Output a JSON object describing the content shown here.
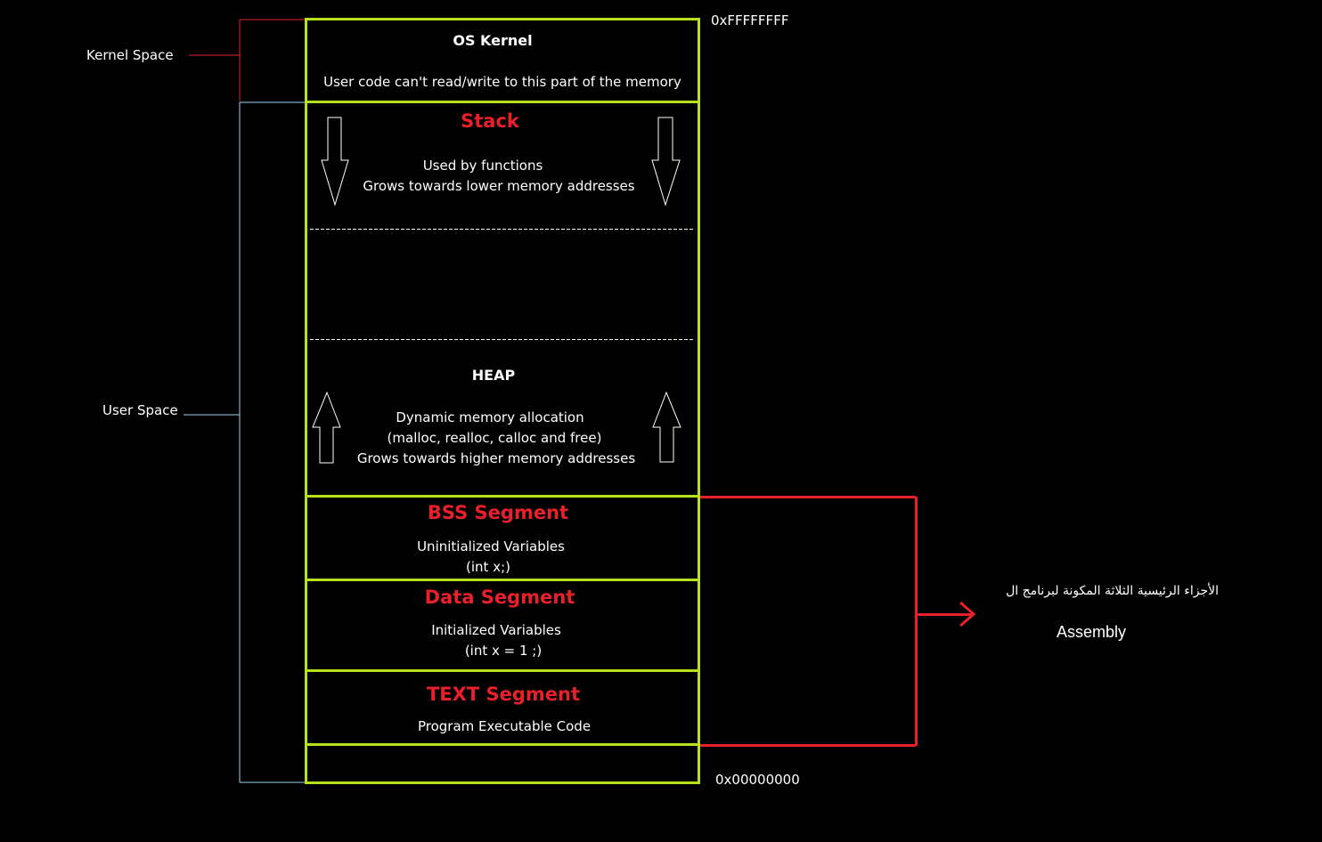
{
  "address_labels": {
    "top": "0xFFFFFFFF",
    "bottom": "0x00000000"
  },
  "space_labels": {
    "kernel": "Kernel Space",
    "user": "User Space"
  },
  "segments": {
    "kernel": {
      "title": "OS Kernel",
      "lines": [
        "User code can't read/write to this part of the memory"
      ]
    },
    "stack": {
      "title": "Stack",
      "lines": [
        "Used by functions",
        "Grows towards lower memory addresses"
      ]
    },
    "heap": {
      "title": "HEAP",
      "lines": [
        "Dynamic memory allocation",
        "(malloc, realloc, calloc and free)",
        "Grows towards higher memory addresses"
      ]
    },
    "bss": {
      "title": "BSS Segment",
      "lines": [
        "Uninitialized Variables",
        "(int x;)"
      ]
    },
    "data": {
      "title": "Data Segment",
      "lines": [
        "Initialized Variables",
        "(int x = 1 ;)"
      ]
    },
    "text": {
      "title": "TEXT Segment",
      "lines": [
        "Program Executable Code"
      ]
    }
  },
  "annotation": {
    "arabic": "الأجزاء الرئيسية الثلاثة المكونة لبرنامج ال",
    "english": "Assembly"
  },
  "colors": {
    "segment_border": "#b5e21b",
    "heading_red": "#e8202a",
    "kernel_bracket": "#e8202a",
    "user_bracket": "#9dd4f0",
    "bracket_red": "#e8202a"
  }
}
